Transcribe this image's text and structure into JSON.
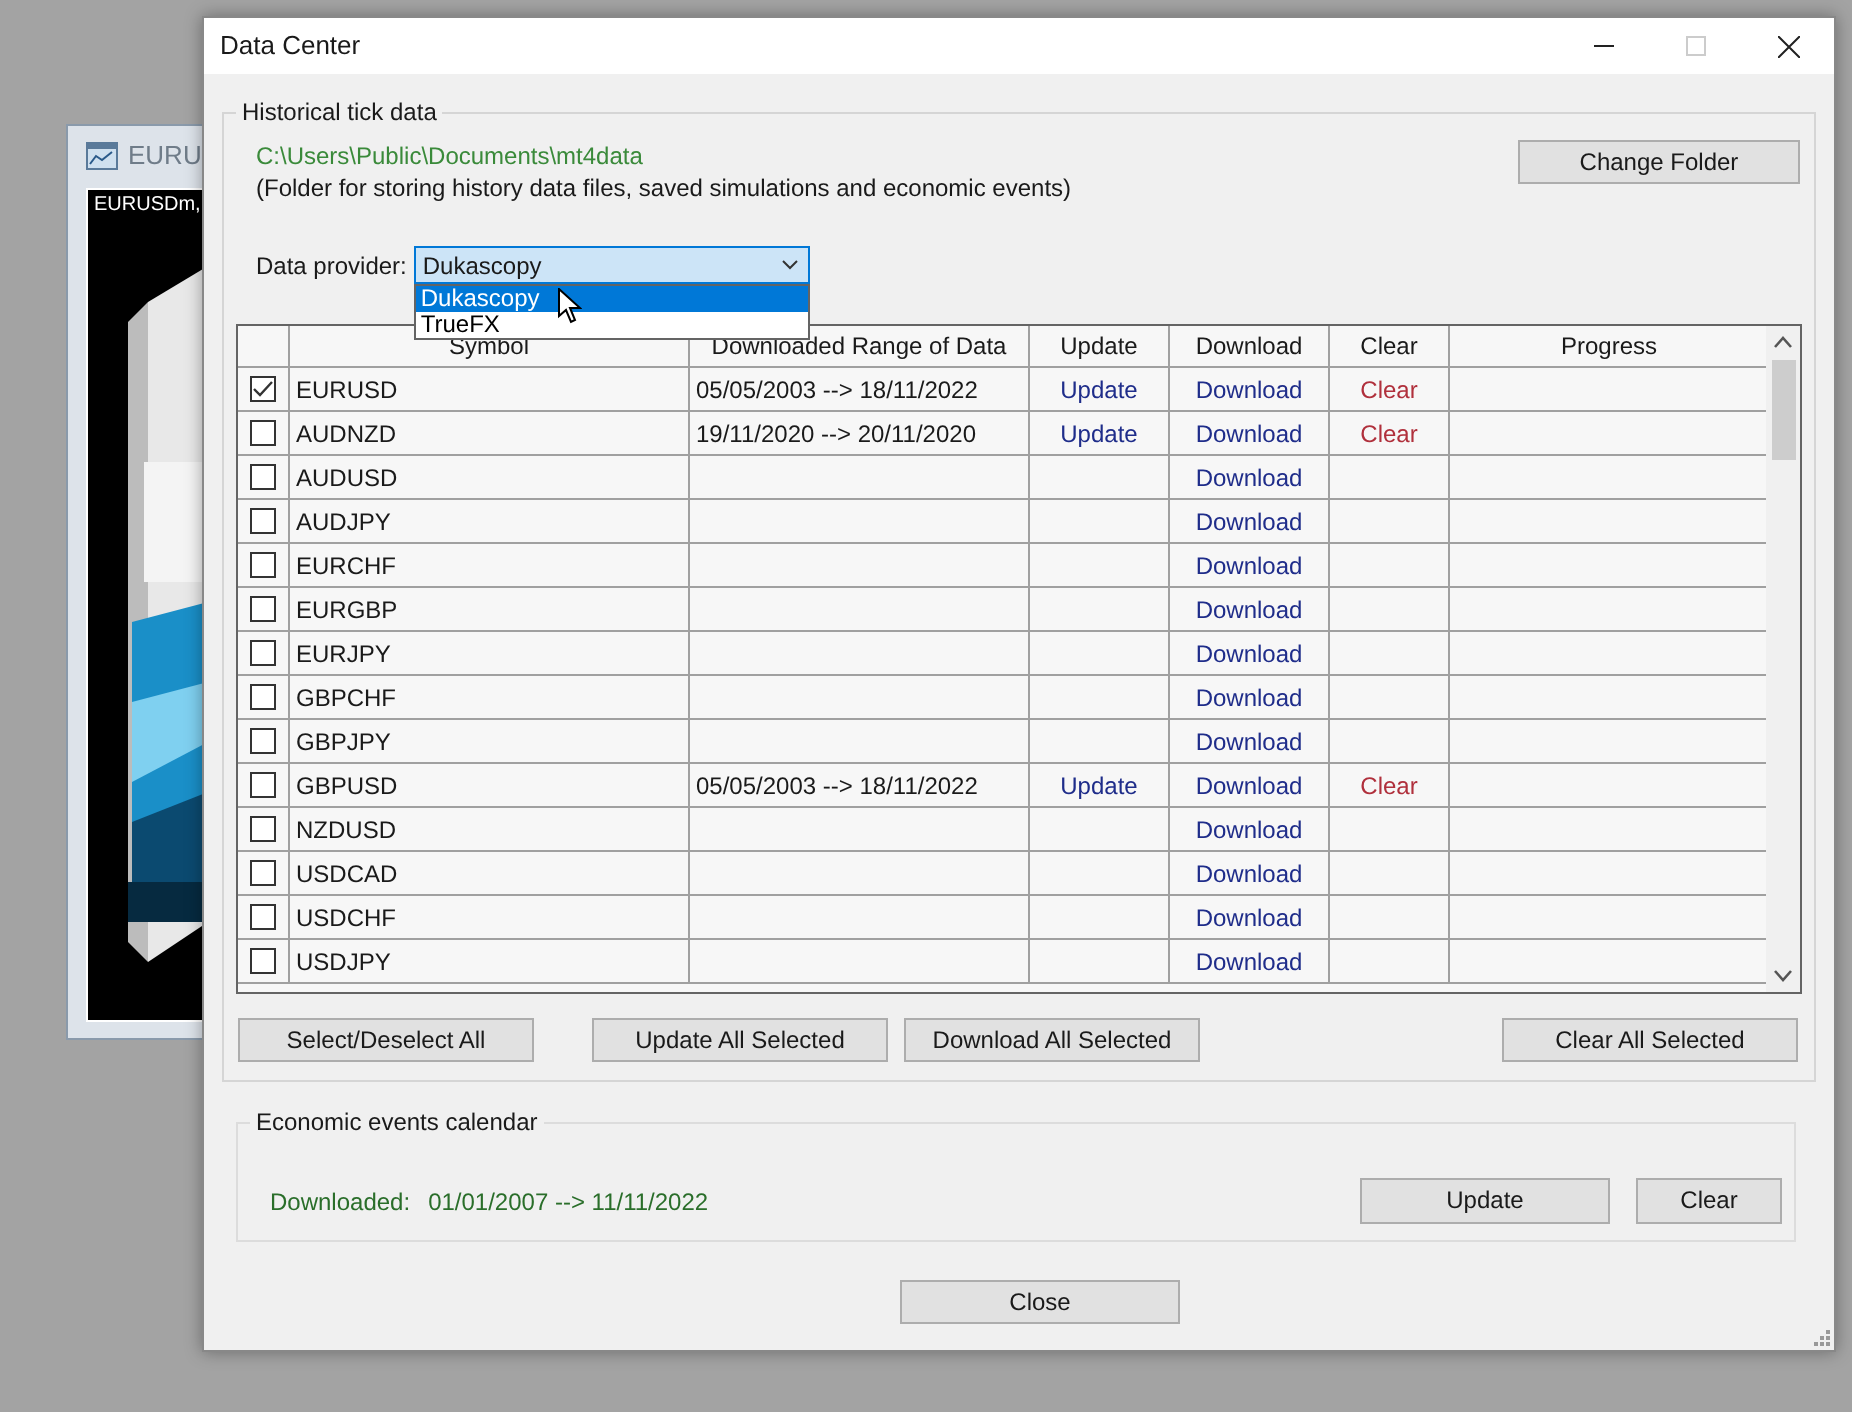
{
  "background_window": {
    "title": "EURU",
    "chart_label": "EURUSDm,"
  },
  "dialog": {
    "title": "Data Center"
  },
  "historical": {
    "legend": "Historical tick data",
    "folder_path": "C:\\Users\\Public\\Documents\\mt4data",
    "folder_note": "(Folder for storing history data files, saved simulations and economic events)",
    "change_folder_button": "Change Folder",
    "provider_label": "Data provider:",
    "provider_value": "Dukascopy",
    "provider_options": [
      {
        "label": "Dukascopy",
        "selected": true
      },
      {
        "label": "TrueFX",
        "selected": false
      }
    ]
  },
  "table": {
    "columns": [
      "Symbol",
      "Downloaded Range of Data",
      "Update",
      "Download",
      "Clear",
      "Progress"
    ],
    "rows": [
      {
        "checked": true,
        "symbol": "EURUSD",
        "range": "05/05/2003 --> 18/11/2022",
        "update": "Update",
        "download": "Download",
        "clear": "Clear"
      },
      {
        "checked": false,
        "symbol": "AUDNZD",
        "range": "19/11/2020 --> 20/11/2020",
        "update": "Update",
        "download": "Download",
        "clear": "Clear"
      },
      {
        "checked": false,
        "symbol": "AUDUSD",
        "download": "Download"
      },
      {
        "checked": false,
        "symbol": "AUDJPY",
        "download": "Download"
      },
      {
        "checked": false,
        "symbol": "EURCHF",
        "download": "Download"
      },
      {
        "checked": false,
        "symbol": "EURGBP",
        "download": "Download"
      },
      {
        "checked": false,
        "symbol": "EURJPY",
        "download": "Download"
      },
      {
        "checked": false,
        "symbol": "GBPCHF",
        "download": "Download"
      },
      {
        "checked": false,
        "symbol": "GBPJPY",
        "download": "Download"
      },
      {
        "checked": false,
        "symbol": "GBPUSD",
        "range": "05/05/2003 --> 18/11/2022",
        "update": "Update",
        "download": "Download",
        "clear": "Clear"
      },
      {
        "checked": false,
        "symbol": "NZDUSD",
        "download": "Download"
      },
      {
        "checked": false,
        "symbol": "USDCAD",
        "download": "Download"
      },
      {
        "checked": false,
        "symbol": "USDCHF",
        "download": "Download"
      },
      {
        "checked": false,
        "symbol": "USDJPY",
        "download": "Download"
      }
    ]
  },
  "table_buttons": [
    "Select/Deselect All",
    "Update All Selected",
    "Download All Selected",
    "Clear All Selected"
  ],
  "economic": {
    "legend": "Economic events calendar",
    "downloaded_label": "Downloaded:",
    "downloaded_value": "01/01/2007 --> 11/11/2022",
    "update_button": "Update",
    "clear_button": "Clear"
  },
  "close_button": "Close"
}
